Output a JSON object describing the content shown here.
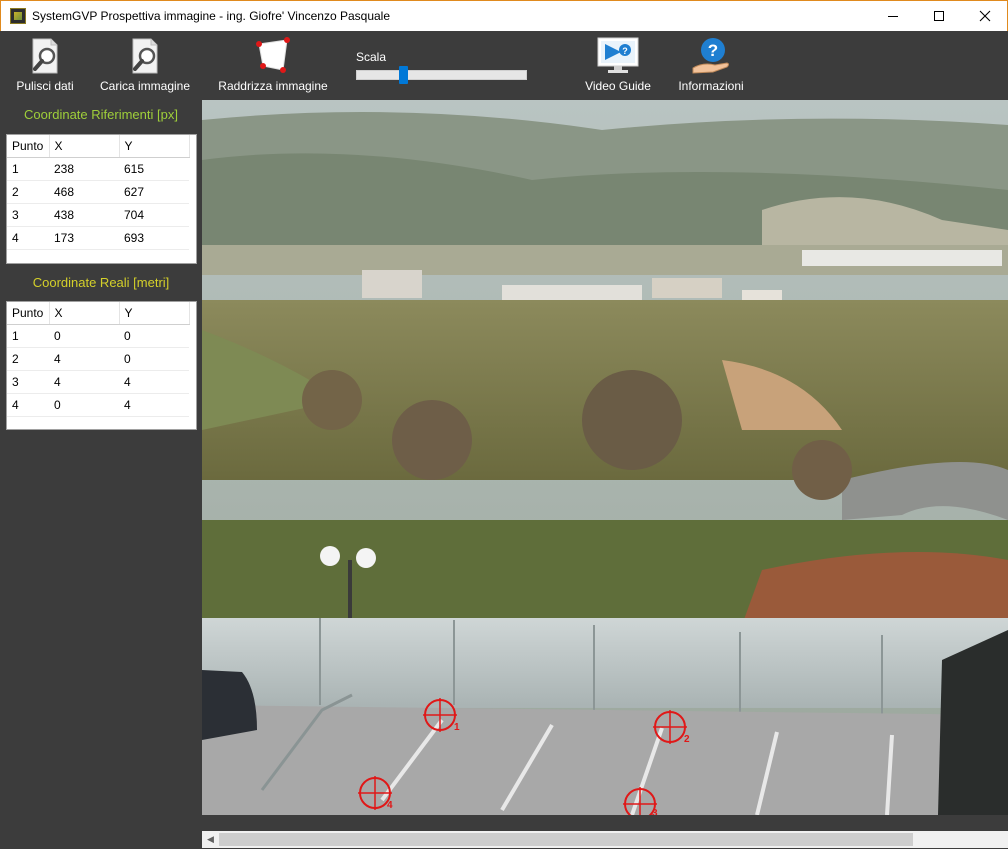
{
  "window": {
    "title": "SystemGVP Prospettiva immagine - ing. Giofre' Vincenzo Pasquale"
  },
  "toolbar": {
    "clear_label": "Pulisci dati",
    "load_label": "Carica immagine",
    "rectify_label": "Raddrizza immagine",
    "scale_label": "Scala",
    "scale_value": 0.26,
    "video_label": "Video Guide",
    "info_label": "Informazioni"
  },
  "ref_coords": {
    "title": "Coordinate Riferimenti [px]",
    "columns": [
      "Punto",
      "X",
      "Y"
    ],
    "rows": [
      [
        "1",
        "238",
        "615"
      ],
      [
        "2",
        "468",
        "627"
      ],
      [
        "3",
        "438",
        "704"
      ],
      [
        "4",
        "173",
        "693"
      ]
    ]
  },
  "real_coords": {
    "title": "Coordinate Reali [metri]",
    "columns": [
      "Punto",
      "X",
      "Y"
    ],
    "rows": [
      [
        "1",
        "0",
        "0"
      ],
      [
        "2",
        "4",
        "0"
      ],
      [
        "3",
        "4",
        "4"
      ],
      [
        "4",
        "0",
        "4"
      ]
    ]
  },
  "markers": [
    {
      "label": "1"
    },
    {
      "label": "2"
    },
    {
      "label": "3"
    },
    {
      "label": "4"
    }
  ],
  "colors": {
    "accent": "#e08a1e",
    "marker": "#e01818",
    "panel_title_ref": "#9fcf3a",
    "panel_title_real": "#d4d02a",
    "background": "#3c3c3c"
  }
}
